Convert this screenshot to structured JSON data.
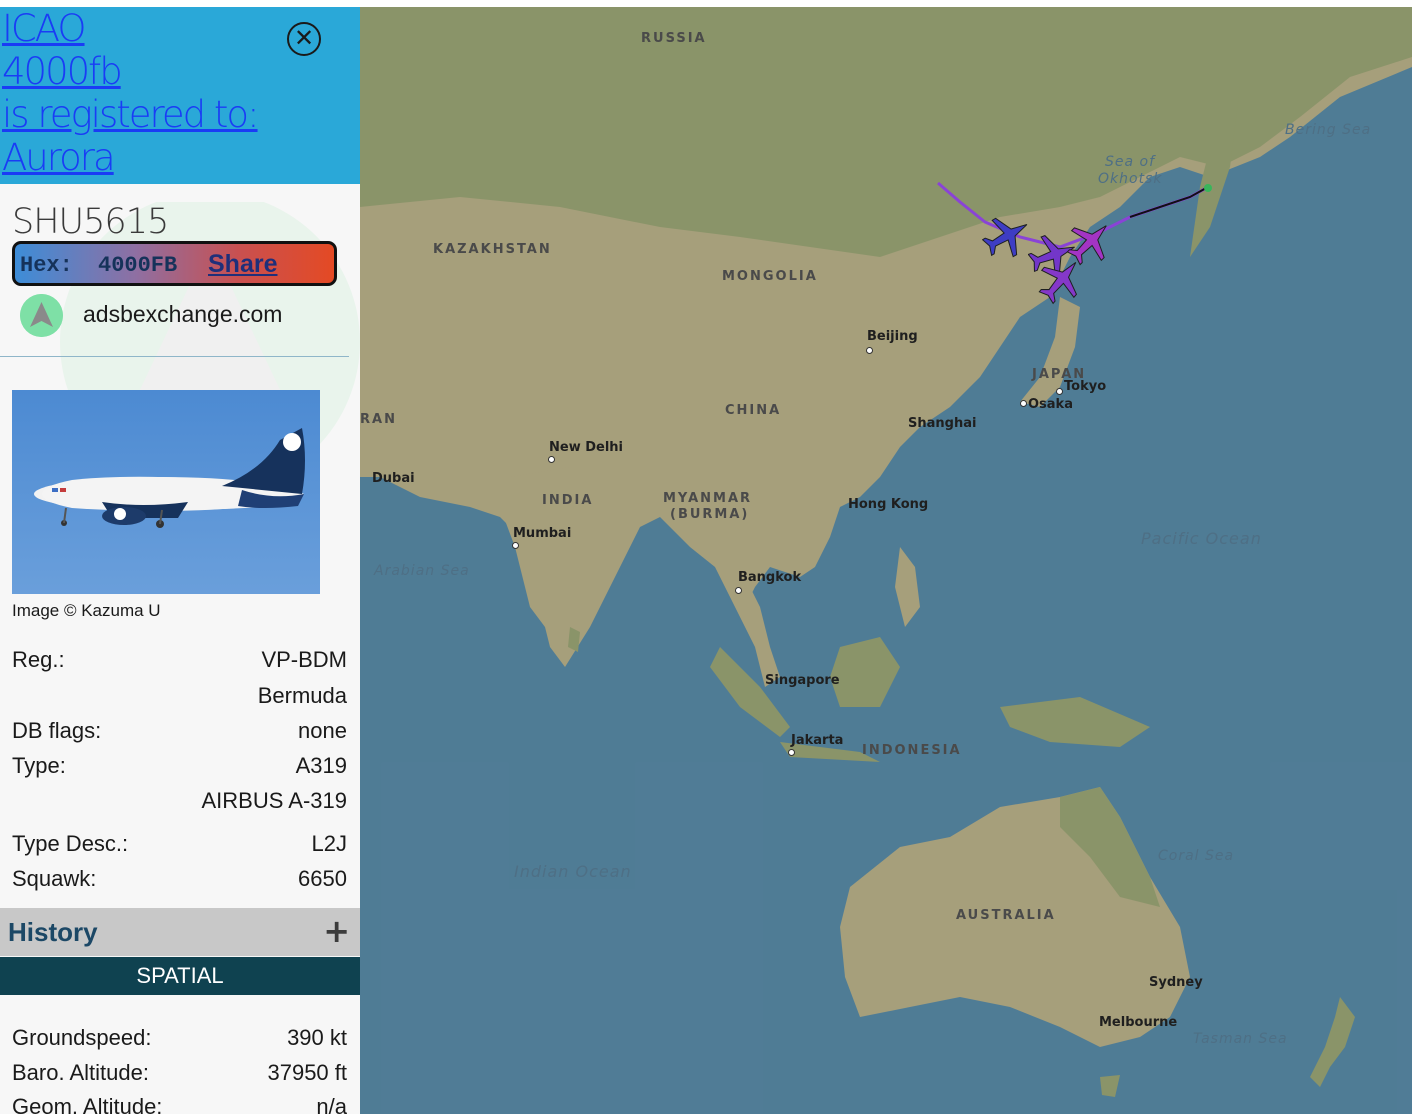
{
  "header": {
    "icao_label": "ICAO",
    "icao": "4000fb",
    "registered_to_label": "is registered to:",
    "owner": "Aurora"
  },
  "aircraft": {
    "callsign": "SHU5615",
    "hex_label": "Hex:",
    "hex": "4000FB",
    "share_label": "Share",
    "source_site": "adsbexchange.com",
    "photo_credit": "Image © Kazuma U"
  },
  "details": {
    "reg_label": "Reg.:",
    "reg": "VP-BDM",
    "country": "Bermuda",
    "db_flags_label": "DB flags:",
    "db_flags": "none",
    "type_label": "Type:",
    "type": "A319",
    "type_name": "AIRBUS A-319",
    "type_desc_label": "Type Desc.:",
    "type_desc": "L2J",
    "squawk_label": "Squawk:",
    "squawk": "6650"
  },
  "history": {
    "label": "History",
    "toggle": "+"
  },
  "spatial": {
    "label": "SPATIAL",
    "groundspeed_label": "Groundspeed:",
    "groundspeed": "390 kt",
    "baro_alt_label": "Baro. Altitude:",
    "baro_alt": "37950 ft",
    "geom_alt_label": "Geom. Altitude:",
    "geom_alt": "n/a"
  },
  "map": {
    "labels": {
      "russia": "RUSSIA",
      "kazakhstan": "KAZAKHSTAN",
      "mongolia": "MONGOLIA",
      "china": "CHINA",
      "japan": "JAPAN",
      "india": "INDIA",
      "myanmar": "MYANMAR",
      "burma": "(BURMA)",
      "indonesia": "INDONESIA",
      "australia": "AUSTRALIA",
      "iran": "RAN",
      "bering_sea": "Bering Sea",
      "sea_of_okhotsk_1": "Sea of",
      "sea_of_okhotsk_2": "Okhotsk",
      "pacific_ocean": "Pacific Ocean",
      "arabian_sea": "Arabian Sea",
      "indian_ocean": "Indian Ocean",
      "coral_sea": "Coral Sea",
      "tasman_sea": "Tasman Sea",
      "beijing": "Beijing",
      "shanghai": "Shanghai",
      "tokyo": "Tokyo",
      "osaka": "Osaka",
      "new_delhi": "New Delhi",
      "dubai": "Dubai",
      "mumbai": "Mumbai",
      "hong_kong": "Hong Kong",
      "bangkok": "Bangkok",
      "singapore": "Singapore",
      "jakarta": "Jakarta",
      "sydney": "Sydney",
      "melbourne": "Melbourne"
    },
    "colors": {
      "land": "#c8bd91",
      "land_green": "#a7b07a",
      "water": "#5f93b0",
      "track": "#a64dff"
    }
  }
}
